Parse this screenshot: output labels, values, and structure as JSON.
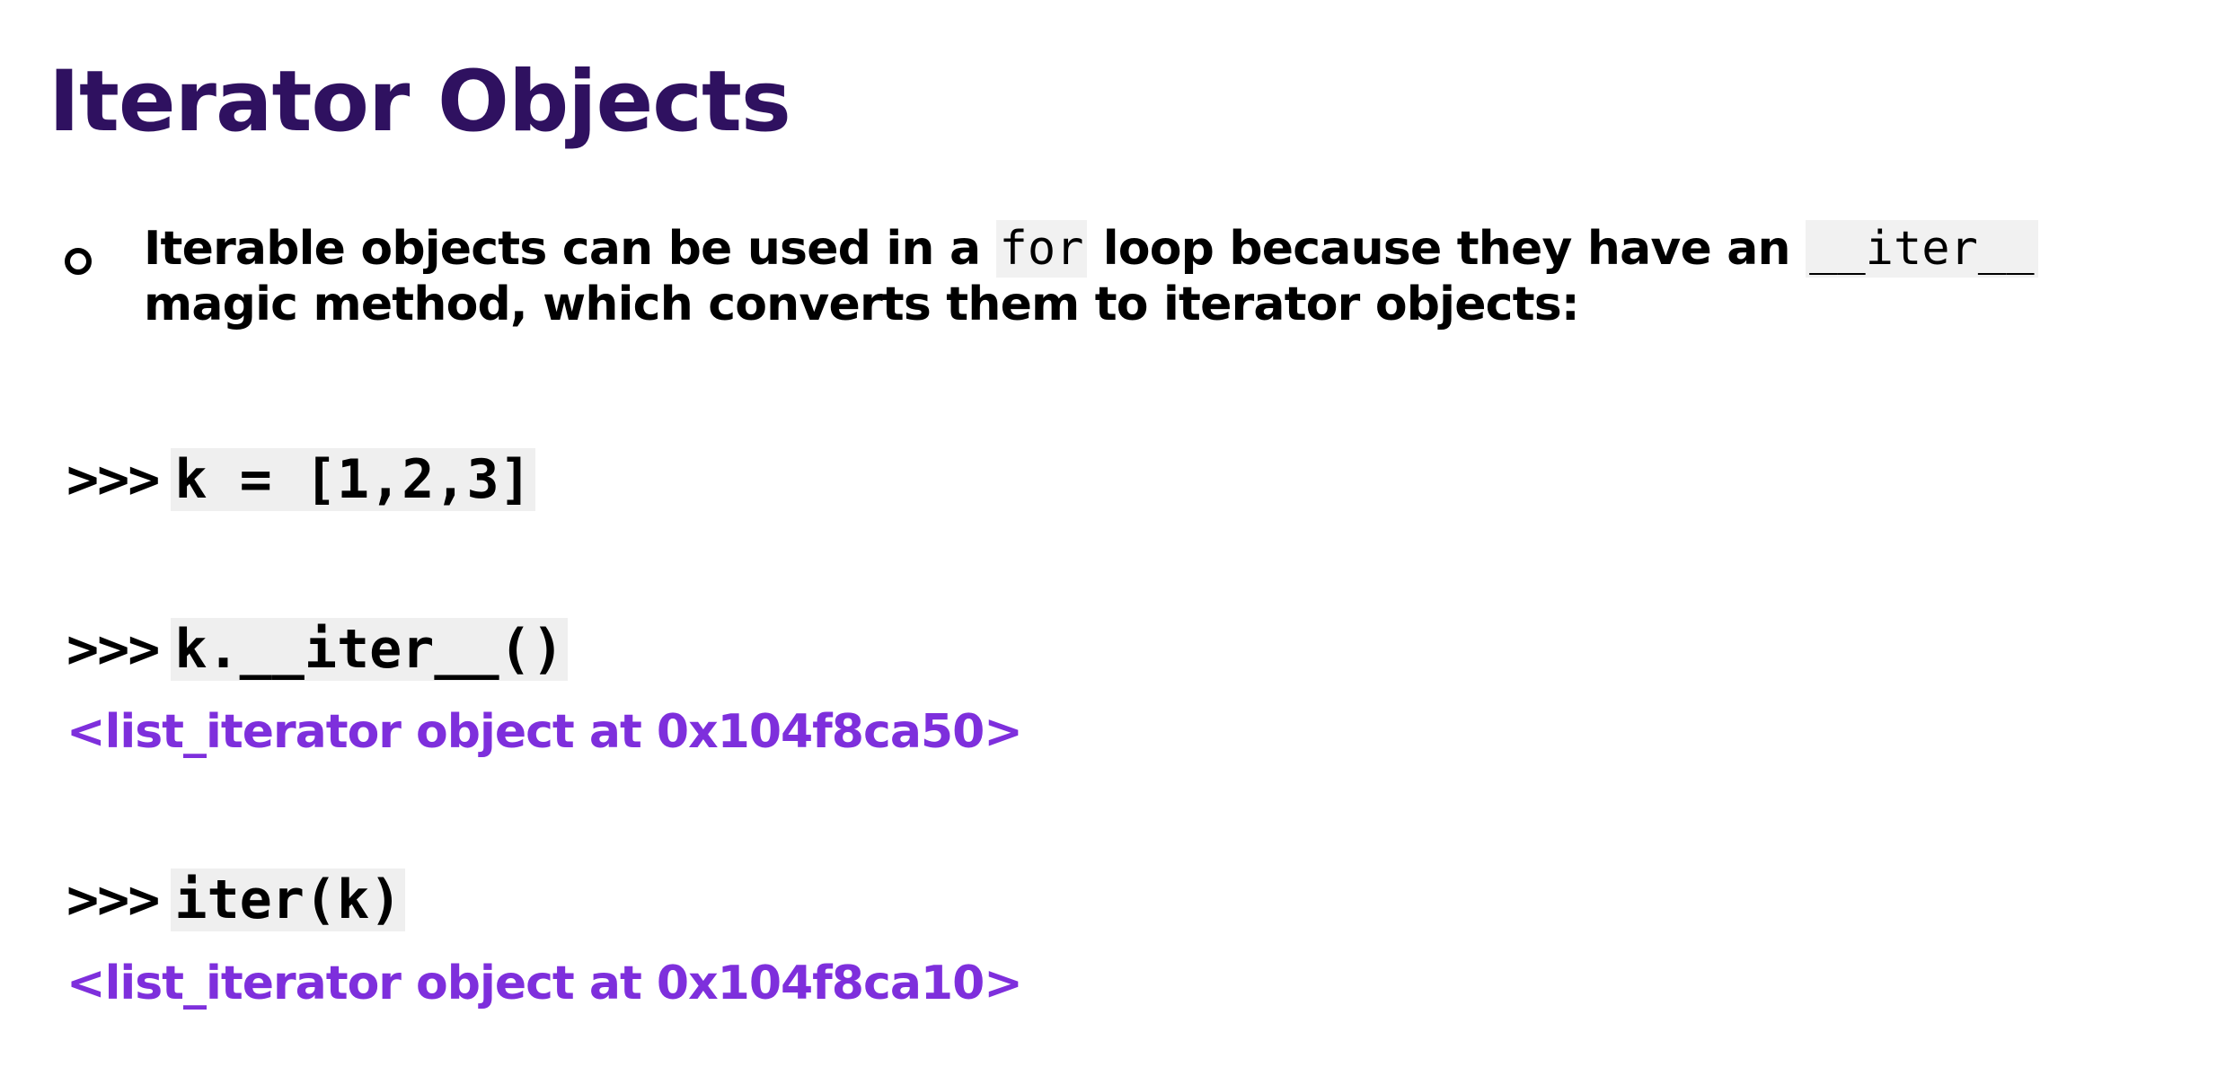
{
  "title": "Iterator Objects",
  "bullet": {
    "text_1": "Iterable objects can be used in a ",
    "code_1": "for",
    "text_2": " loop because they have an ",
    "code_2": "__iter__",
    "text_3": " magic method, which converts them to iterator objects:"
  },
  "lines": [
    {
      "prompt": ">>>",
      "command": "k = [1,2,3]"
    },
    {
      "prompt": ">>>",
      "command": "k.__iter__()",
      "output": "<list_iterator object at 0x104f8ca50>"
    },
    {
      "prompt": ">>>",
      "command": "iter(k)",
      "output": "<list_iterator object at 0x104f8ca10>"
    }
  ],
  "colors": {
    "title": "#2f1160",
    "output": "#7e2fdc",
    "code_background": "#efefef"
  }
}
